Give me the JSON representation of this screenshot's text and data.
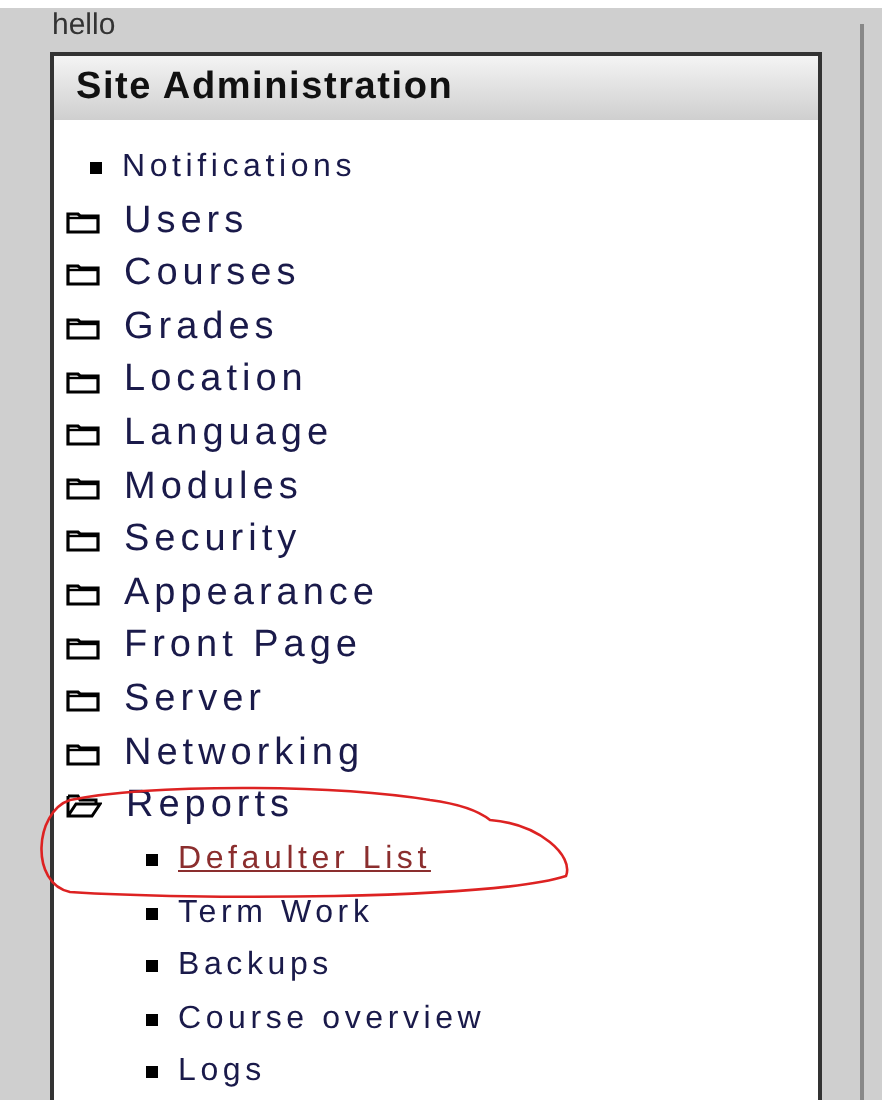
{
  "greeting": "hello",
  "block": {
    "title": "Site Administration",
    "items": [
      {
        "kind": "leaf",
        "label": "Notifications"
      },
      {
        "kind": "folder",
        "label": "Users",
        "expanded": false
      },
      {
        "kind": "folder",
        "label": "Courses",
        "expanded": false
      },
      {
        "kind": "folder",
        "label": "Grades",
        "expanded": false
      },
      {
        "kind": "folder",
        "label": "Location",
        "expanded": false
      },
      {
        "kind": "folder",
        "label": "Language",
        "expanded": false
      },
      {
        "kind": "folder",
        "label": "Modules",
        "expanded": false
      },
      {
        "kind": "folder",
        "label": "Security",
        "expanded": false
      },
      {
        "kind": "folder",
        "label": "Appearance",
        "expanded": false
      },
      {
        "kind": "folder",
        "label": "Front Page",
        "expanded": false
      },
      {
        "kind": "folder",
        "label": "Server",
        "expanded": false
      },
      {
        "kind": "folder",
        "label": "Networking",
        "expanded": false
      },
      {
        "kind": "folder",
        "label": "Reports",
        "expanded": true,
        "children": [
          {
            "kind": "leaf",
            "label": "Defaulter List",
            "selected": true
          },
          {
            "kind": "leaf",
            "label": "Term Work",
            "selected": false
          },
          {
            "kind": "leaf",
            "label": "Backups",
            "selected": false
          },
          {
            "kind": "leaf",
            "label": "Course overview",
            "selected": false
          },
          {
            "kind": "leaf",
            "label": "Logs",
            "selected": false
          }
        ]
      }
    ]
  }
}
